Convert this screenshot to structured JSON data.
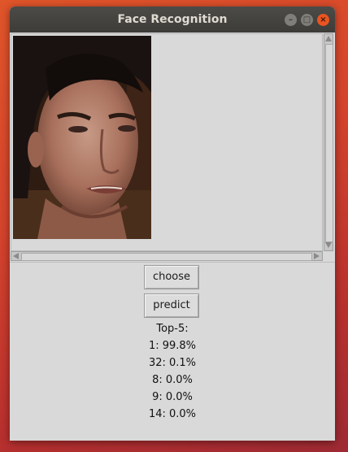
{
  "window": {
    "title": "Face Recognition"
  },
  "buttons": {
    "choose_label": "choose",
    "predict_label": "predict"
  },
  "results": {
    "heading": "Top-5:",
    "items": [
      "1: 99.8%",
      "32: 0.1%",
      "8: 0.0%",
      "9: 0.0%",
      "14: 0.0%"
    ]
  },
  "icons": {
    "minimize": "minimize-icon",
    "maximize": "maximize-icon",
    "close": "close-icon"
  },
  "colors": {
    "titlebar": "#3d3c38",
    "close_button": "#e95420",
    "window_bg": "#d9d9d9"
  }
}
